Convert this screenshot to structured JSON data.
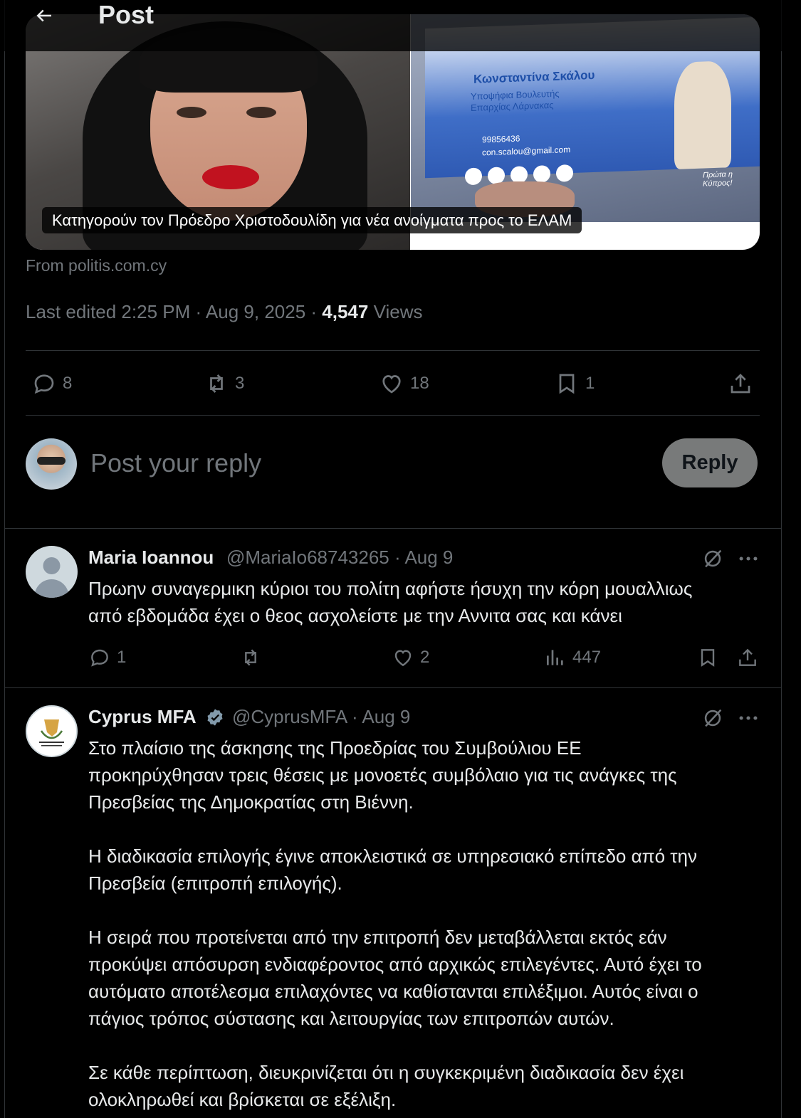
{
  "header": {
    "title": "Post"
  },
  "card": {
    "caption": "Κατηγορούν τον Πρόεδρο Χριστοδουλίδη για νέα ανοίγματα προς το ΕΛΑΜ",
    "businesscard": {
      "name": "Κωνσταντίνα Σκάλου",
      "line1": "Υποψήφια Βουλευτής",
      "line2": "Επαρχίας Λάρνακας",
      "phone": "99856436",
      "email": "con.scalou@gmail.com",
      "slogan": "Πρώτα η Κύπρος!"
    },
    "source": "From politis.com.cy"
  },
  "meta": {
    "edited": "Last edited 2:25 PM · Aug 9, 2025 · ",
    "views_count": "4,547",
    "views_label": " Views"
  },
  "actions": {
    "replies": "8",
    "reposts": "3",
    "likes": "18",
    "bookmarks": "1"
  },
  "composer": {
    "placeholder": "Post your reply",
    "button": "Reply"
  },
  "replies": [
    {
      "name": "Maria Ioannou",
      "handle": "@MariaIo68743265 · Aug 9",
      "text": "Πρωην συναγερμικη κύριοι του πολίτη αφήστε ήσυχη την κόρη μουαλλιως\nαπό εβδομάδα έχει ο θεος ασχολείστε με την Αννιτα σας και κάνει",
      "replies": "1",
      "reposts": "",
      "likes": "2",
      "views": "447"
    },
    {
      "name": "Cyprus MFA",
      "handle": "@CyprusMFA · Aug 9",
      "text": "Στο πλαίσιο της άσκησης της Προεδρίας του Συμβούλιου ΕΕ\nπροκηρύχθησαν τρεις θέσεις με μονοετές συμβόλαιο για τις ανάγκες της\nΠρεσβείας της Δημοκρατίας στη Βιέννη.\n\nΗ διαδικασία επιλογής έγινε αποκλειστικά σε υπηρεσιακό επίπεδο από την\nΠρεσβεία (επιτροπή επιλογής).\n\nΗ σειρά που προτείνεται από την επιτροπή δεν μεταβάλλεται εκτός εάν\nπροκύψει απόσυρση ενδιαφέροντος από αρχικώς επιλεγέντες. Αυτό έχει το\nαυτόματο αποτέλεσμα επιλαχόντες να καθίστανται επιλέξιμοι. Αυτός είναι ο\nπάγιος τρόπος σύστασης και λειτουργίας των επιτροπών αυτών.\n\nΣε κάθε περίπτωση, διευκρινίζεται ότι η συγκεκριμένη διαδικασία δεν έχει\nολοκληρωθεί και βρίσκεται σε εξέλιξη."
    }
  ]
}
